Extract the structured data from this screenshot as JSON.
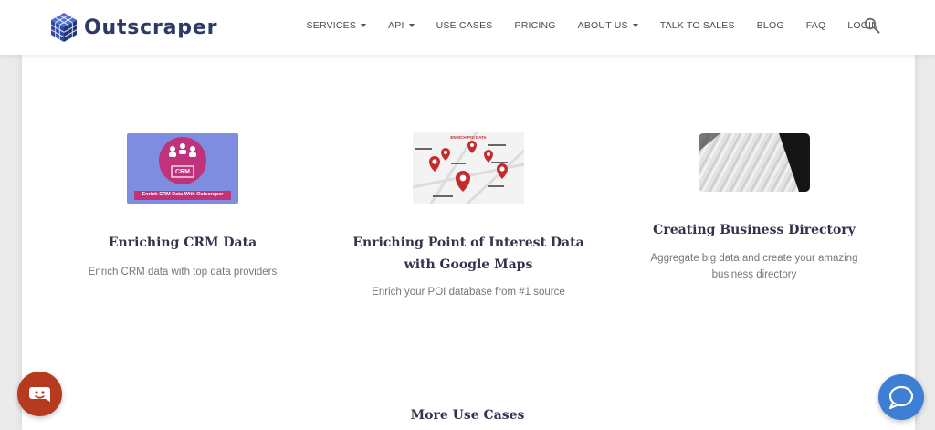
{
  "brand": {
    "name": "Outscraper",
    "color": "#2b3a67"
  },
  "nav": {
    "items": [
      {
        "label": "SERVICES",
        "dropdown": true
      },
      {
        "label": "API",
        "dropdown": true
      },
      {
        "label": "USE CASES",
        "dropdown": false
      },
      {
        "label": "PRICING",
        "dropdown": false
      },
      {
        "label": "ABOUT US",
        "dropdown": true
      },
      {
        "label": "TALK TO SALES",
        "dropdown": false
      },
      {
        "label": "BLOG",
        "dropdown": false
      },
      {
        "label": "FAQ",
        "dropdown": false
      },
      {
        "label": "LOGIN",
        "dropdown": false
      }
    ],
    "search_icon": "search-icon"
  },
  "cards": [
    {
      "title": "Enriching CRM Data",
      "description": "Enrich CRM data with top data providers",
      "image": {
        "badge": "CRM",
        "caption": "Enrich CRM Data With Outscraper",
        "bg": "#7f8de0"
      }
    },
    {
      "title": "Enriching Point of Interest Data with Google Maps",
      "description": "Enrich your POI database from #1 source",
      "image": {
        "caption": "ENRICH POI DATA"
      }
    },
    {
      "title": "Creating Business Directory",
      "description": "Aggregate big data and create your amazing business directory"
    }
  ],
  "more_section": {
    "title": "More Use Cases"
  },
  "widgets": {
    "left": {
      "icon": "smiley-chat-icon",
      "color": "#b53a1e"
    },
    "right": {
      "icon": "chat-bubble-icon",
      "color": "#3d7fd4"
    }
  }
}
